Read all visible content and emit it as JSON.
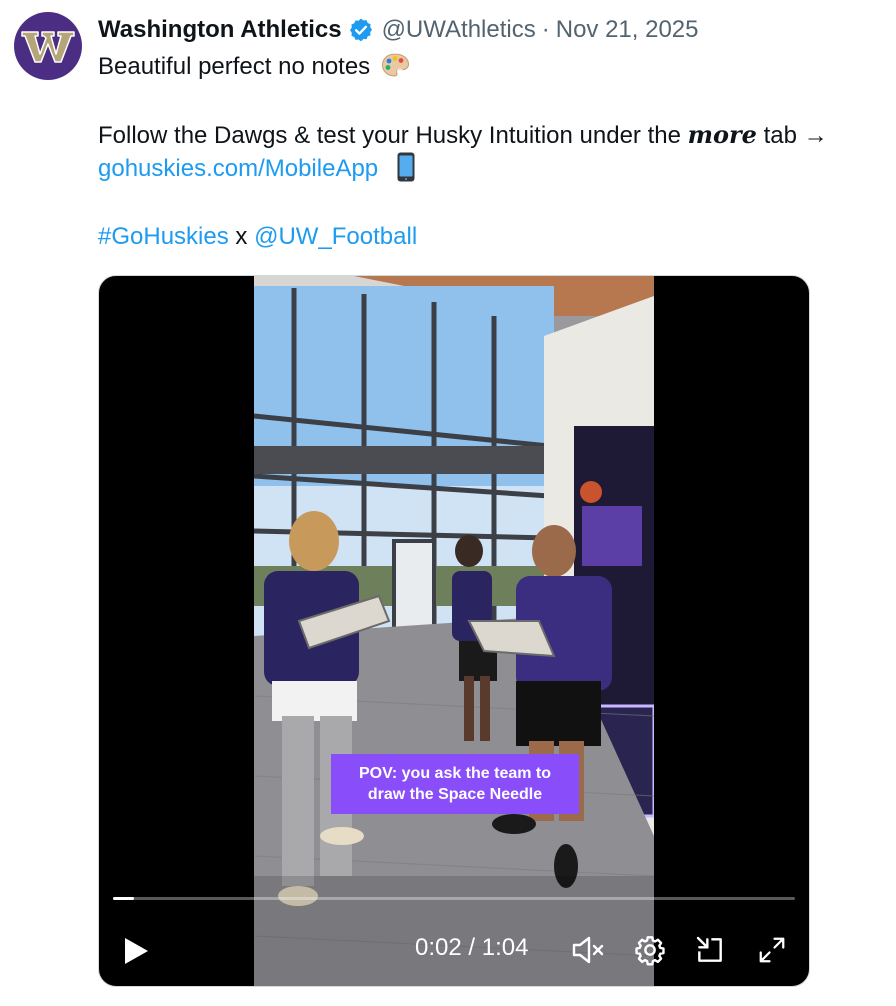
{
  "author": {
    "display_name": "Washington Athletics",
    "handle": "@UWAthletics",
    "separator": "·",
    "date": "Nov 21, 2025",
    "avatar_icon": "uw-w-logo",
    "verified_icon": "verified-badge-icon"
  },
  "tweet": {
    "line1": "Beautiful perfect no notes",
    "line1_emoji": "artist-palette-emoji",
    "line2_prefix": "Follow the Dawgs & test your Husky Intuition under the ",
    "line2_emphasis": "more",
    "line2_suffix": " tab →",
    "link_url": "gohuskies.com/MobileApp",
    "link_emoji": "mobile-phone-emoji",
    "hashtag": "#GoHuskies",
    "x_word": "x",
    "mention": "@UW_Football"
  },
  "video": {
    "caption_line1": "POV: you ask the team to",
    "caption_line2": "draw the Space Needle",
    "time_display": "0:02 / 1:04",
    "progress_fraction": 0.031,
    "controls": {
      "play_icon": "play-icon",
      "mute_icon": "muted-speaker-icon",
      "settings_icon": "gear-icon",
      "pip_icon": "picture-in-picture-icon",
      "fullscreen_icon": "fullscreen-icon"
    }
  },
  "colors": {
    "link": "#1d9bf0",
    "verified": "#1d9bf0",
    "caption_bg": "#8a4dfa",
    "avatar_bg": "#4b2e83"
  }
}
